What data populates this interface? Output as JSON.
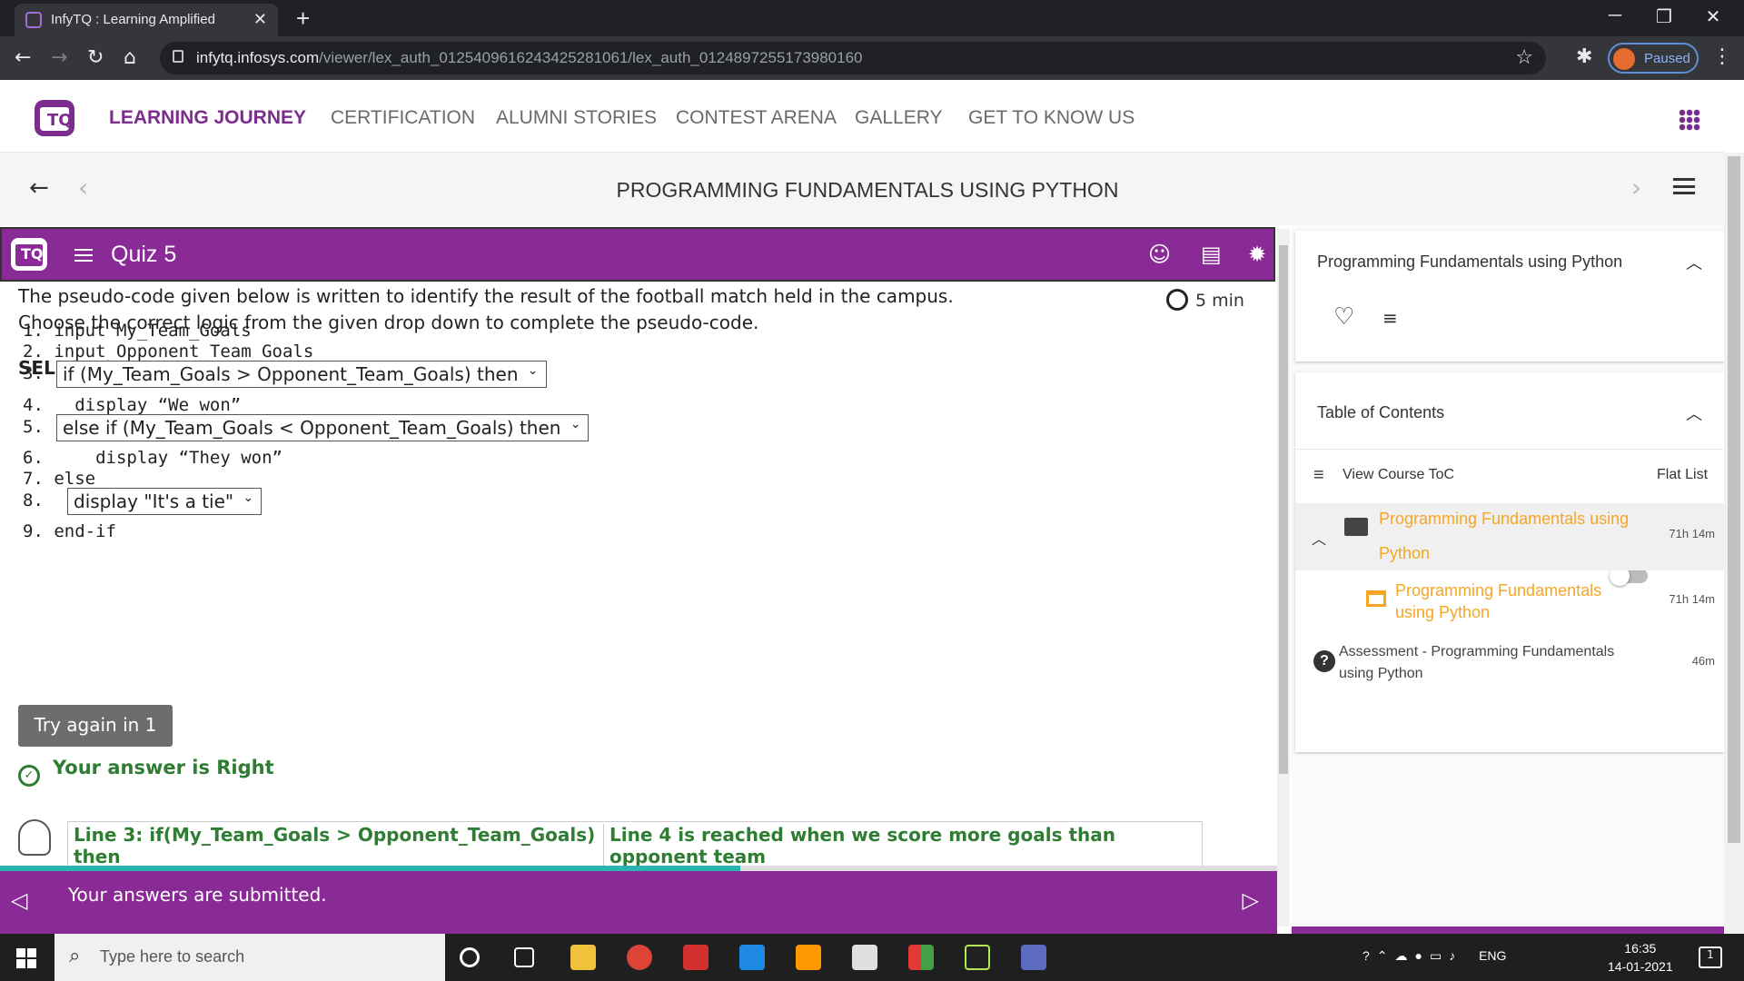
{
  "browser": {
    "tab_title": "InfyTQ : Learning Amplified",
    "url_host": "infytq.infosys.com",
    "url_path": "/viewer/lex_auth_01254096162434252810​61/lex_auth_0124897255173980160",
    "profile_status": "Paused"
  },
  "site_nav": {
    "items": [
      "LEARNING JOURNEY",
      "CERTIFICATION",
      "ALUMNI STORIES",
      "CONTEST ARENA",
      "GALLERY",
      "GET TO KNOW US"
    ]
  },
  "course": {
    "title": "PROGRAMMING FUNDAMENTALS USING PYTHON"
  },
  "quiz": {
    "title": "Quiz 5",
    "timer": "5 min",
    "question_line1": "The pseudo-code given below is written to identify the result of the football match held in the campus.",
    "question_line2": "Choose the correct logic from the given drop down to complete the pseudo-code.",
    "heading": "SELECTION",
    "code_lines": {
      "l1": "1. input My_Team_Goals",
      "l2": "2. input Opponent_Team_Goals",
      "l3": "3.",
      "l4": "4.   display “We won”",
      "l5": "5.",
      "l6": "6.     display “They won”",
      "l7": "7. else",
      "l8": "8.",
      "l9": "9. end-if"
    },
    "dropdowns": {
      "d1": "if (My_Team_Goals > Opponent_Team_Goals) then",
      "d2": "else if (My_Team_Goals < Opponent_Team_Goals) then",
      "d3": "display \"It's a tie\""
    },
    "try_again": "Try again in 1",
    "answer_status": "Your answer is Right",
    "feedback": {
      "left": "Line 3: if(My_Team_Goals > Opponent_Team_Goals) then",
      "right": "Line 4 is reached when we score more goals than opponent team"
    },
    "submitted_message": "Your answers are submitted.",
    "progress_fraction": 0.58
  },
  "right_panel": {
    "course_card_title": "Programming Fundamentals using Python",
    "toc_title": "Table of Contents",
    "view_toc": "View Course ToC",
    "flat_list": "Flat List",
    "items": [
      {
        "label": "Programming Fundamentals using Python",
        "duration": "71h 14m"
      },
      {
        "label": "Programming Fundamentals using Python",
        "duration": "71h 14m"
      },
      {
        "label": "Assessment - Programming Fundamentals using Python",
        "duration": "46m"
      }
    ]
  },
  "taskbar": {
    "search_placeholder": "Type here to search",
    "lang": "ENG",
    "time": "16:35",
    "date": "14-01-2021",
    "notifications": "1"
  },
  "colors": {
    "brand_purple": "#8a2a96",
    "correct_green": "#2e7d32",
    "toc_orange": "#f5a623"
  }
}
